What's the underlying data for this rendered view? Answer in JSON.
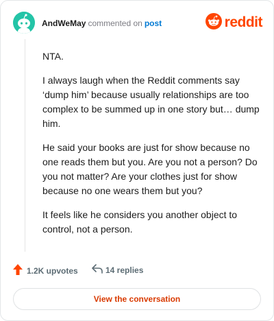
{
  "header": {
    "username": "AndWeMay",
    "commented_text": "commented on",
    "post_link": "post",
    "brand_name": "reddit"
  },
  "comment": {
    "paragraphs": [
      "NTA.",
      "I always laugh when the Reddit comments say ‘dump him’ because usually relationships are too complex to be summed up in one story but… dump him.",
      "He said your books are just for show because no one reads them but you. Are you not a person? Do you not matter? Are your clothes just for show because no one wears them but you?",
      "It feels like he considers you another object to control, not a person."
    ]
  },
  "actions": {
    "upvotes": "1.2K upvotes",
    "replies": "14 replies"
  },
  "cta": {
    "label": "View the conversation"
  },
  "colors": {
    "brand": "#ff4500",
    "avatar": "#24c4a7",
    "link": "#0079d3",
    "cta_text": "#d93a00"
  },
  "icons": {
    "avatar": "snoo-avatar-icon",
    "brand": "reddit-logo-icon",
    "upvote": "upvote-arrow-icon",
    "reply": "reply-arrow-icon"
  }
}
